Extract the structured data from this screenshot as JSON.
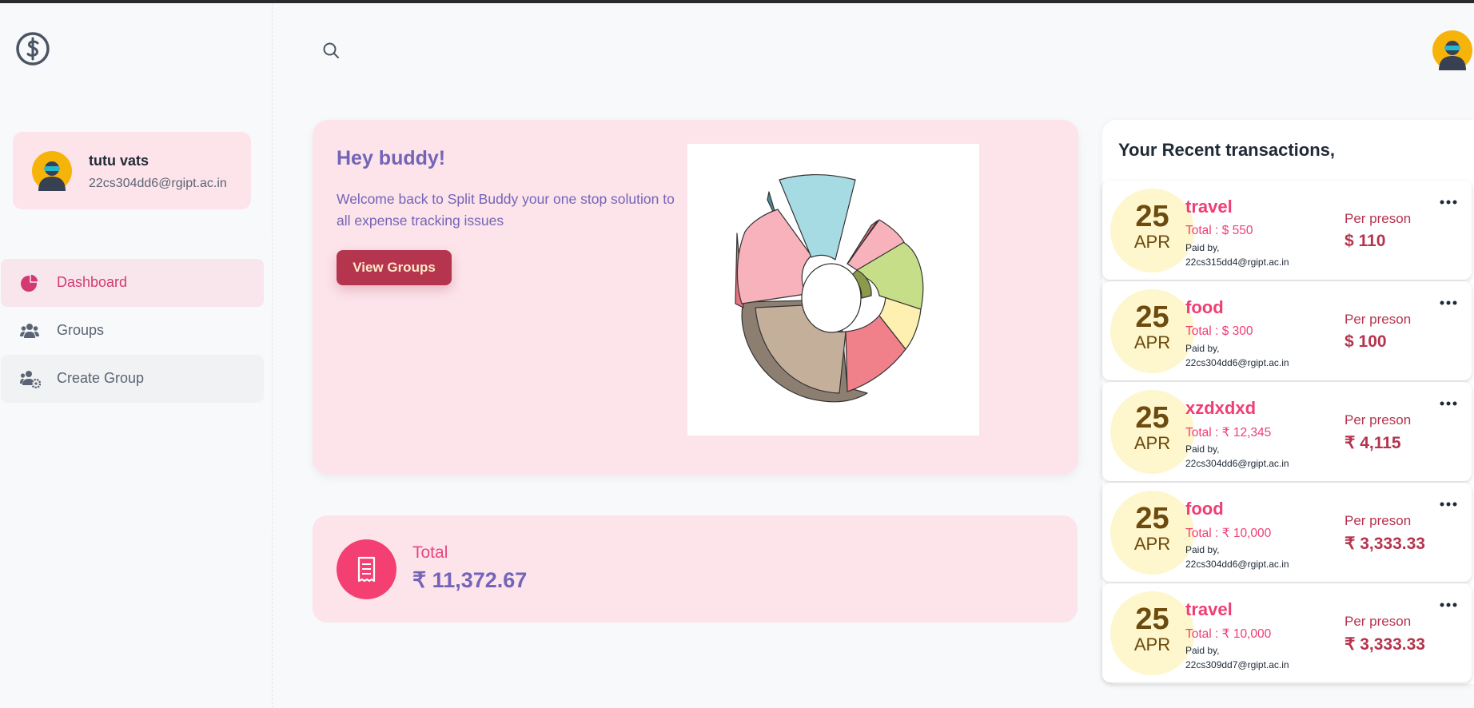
{
  "user": {
    "name": "tutu vats",
    "email": "22cs304dd6@rgipt.ac.in"
  },
  "nav": [
    {
      "label": "Dashboard",
      "icon": "pie-chart-icon"
    },
    {
      "label": "Groups",
      "icon": "users-icon"
    },
    {
      "label": "Create Group",
      "icon": "users-cog-icon"
    }
  ],
  "hero": {
    "title": "Hey buddy!",
    "message": "Welcome back to Split Buddy your one stop solution to all expense tracking issues",
    "button_label": "View Groups"
  },
  "total": {
    "label": "Total",
    "value": "₹ 11,372.67",
    "icon": "receipt-icon"
  },
  "transactions_title": "Your Recent transactions,",
  "transactions": [
    {
      "day": "25",
      "month": "APR",
      "category": "travel",
      "total": "Total : $ 550",
      "paid_label": "Paid by,",
      "payer": "22cs315dd4@rgipt.ac.in",
      "per_label": "Per preson",
      "per_value": "$ 110"
    },
    {
      "day": "25",
      "month": "APR",
      "category": "food",
      "total": "Total : $ 300",
      "paid_label": "Paid by,",
      "payer": "22cs304dd6@rgipt.ac.in",
      "per_label": "Per preson",
      "per_value": "$ 100"
    },
    {
      "day": "25",
      "month": "APR",
      "category": "xzdxdxd",
      "total": "Total : ₹ 12,345",
      "paid_label": "Paid by,",
      "payer": "22cs304dd6@rgipt.ac.in",
      "per_label": "Per preson",
      "per_value": "₹ 4,115"
    },
    {
      "day": "25",
      "month": "APR",
      "category": "food",
      "total": "Total : ₹ 10,000",
      "paid_label": "Paid by,",
      "payer": "22cs304dd6@rgipt.ac.in",
      "per_label": "Per preson",
      "per_value": "₹ 3,333.33"
    },
    {
      "day": "25",
      "month": "APR",
      "category": "travel",
      "total": "Total : ₹ 10,000",
      "paid_label": "Paid by,",
      "payer": "22cs309dd7@rgipt.ac.in",
      "per_label": "Per preson",
      "per_value": "₹ 3,333.33"
    }
  ],
  "colors": {
    "accent_pink": "#ef3e74",
    "button": "#b5344e",
    "purple_text": "#7464b8",
    "card_pink": "#fce4ea",
    "date_circle": "#fef6cc"
  }
}
